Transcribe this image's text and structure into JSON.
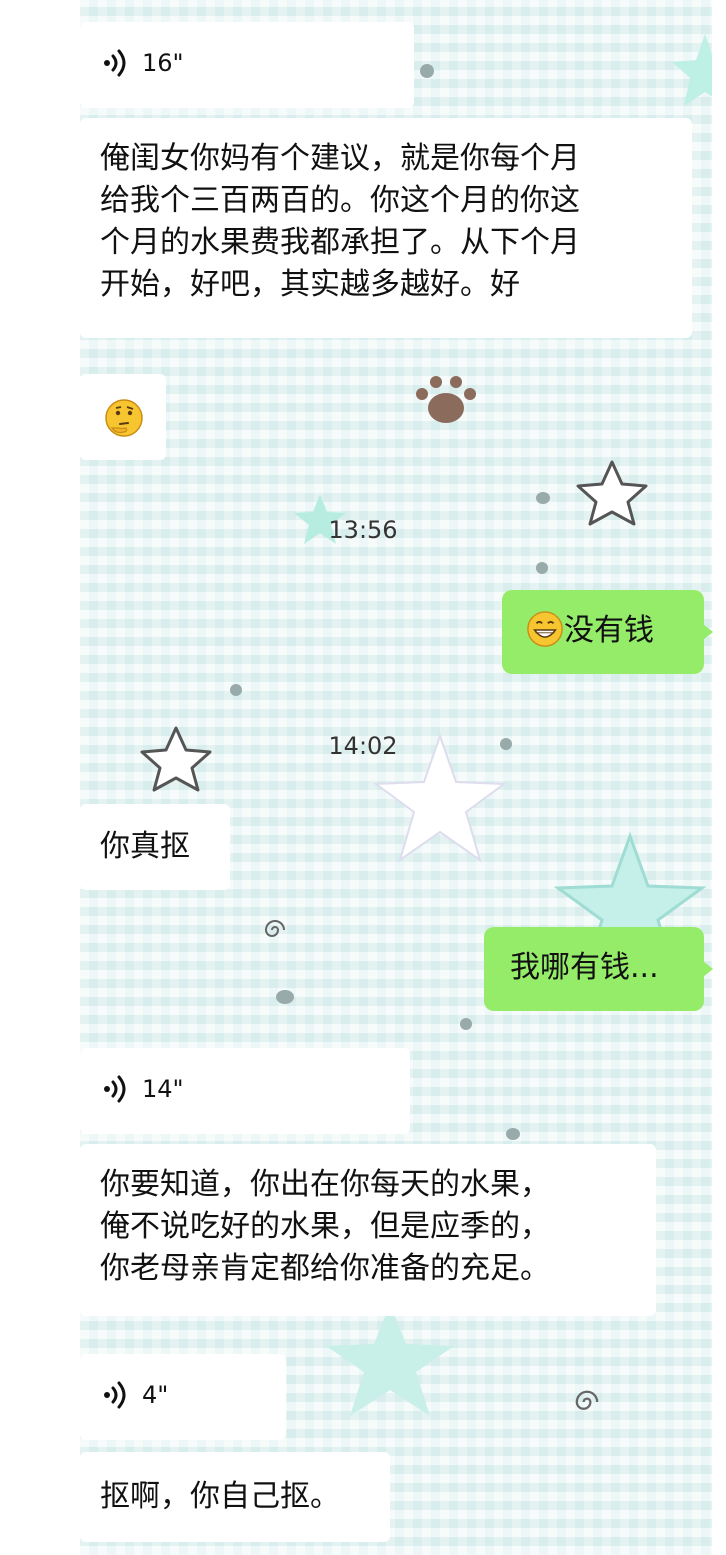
{
  "messages": [
    {
      "id": "m1",
      "side": "left",
      "type": "voice",
      "duration": "16\""
    },
    {
      "id": "m2",
      "side": "left",
      "type": "text",
      "lines": [
        "俺闺女你妈有个建议，就是你每个月",
        "给我个三百两百的。你这个月的你这",
        "个月的水果费我都承担了。从下个月",
        "开始，好吧，其实越多越好。好"
      ]
    },
    {
      "id": "m3",
      "side": "left",
      "type": "emoji",
      "emoji": "thinking-face-icon"
    },
    {
      "id": "t1",
      "type": "time",
      "text": "13:56"
    },
    {
      "id": "m4",
      "side": "right",
      "type": "text",
      "emoji": "grinning-face-icon",
      "text": "没有钱"
    },
    {
      "id": "t2",
      "type": "time",
      "text": "14:02"
    },
    {
      "id": "m5",
      "side": "left",
      "type": "text",
      "text": "你真抠"
    },
    {
      "id": "m6",
      "side": "right",
      "type": "text",
      "text": "我哪有钱..."
    },
    {
      "id": "m7",
      "side": "left",
      "type": "voice",
      "duration": "14\""
    },
    {
      "id": "m8",
      "side": "left",
      "type": "text",
      "lines": [
        "你要知道，你出在你每天的水果，",
        "俺不说吃好的水果，但是应季的，",
        "你老母亲肯定都给你准备的充足。"
      ]
    },
    {
      "id": "m9",
      "side": "left",
      "type": "voice",
      "duration": "4\""
    },
    {
      "id": "m10",
      "side": "left",
      "type": "text",
      "text": "抠啊，你自己抠。"
    }
  ],
  "colors": {
    "left_bubble": "#ffffff",
    "right_bubble": "#95ec69",
    "chat_background": "#e6f4f3"
  }
}
